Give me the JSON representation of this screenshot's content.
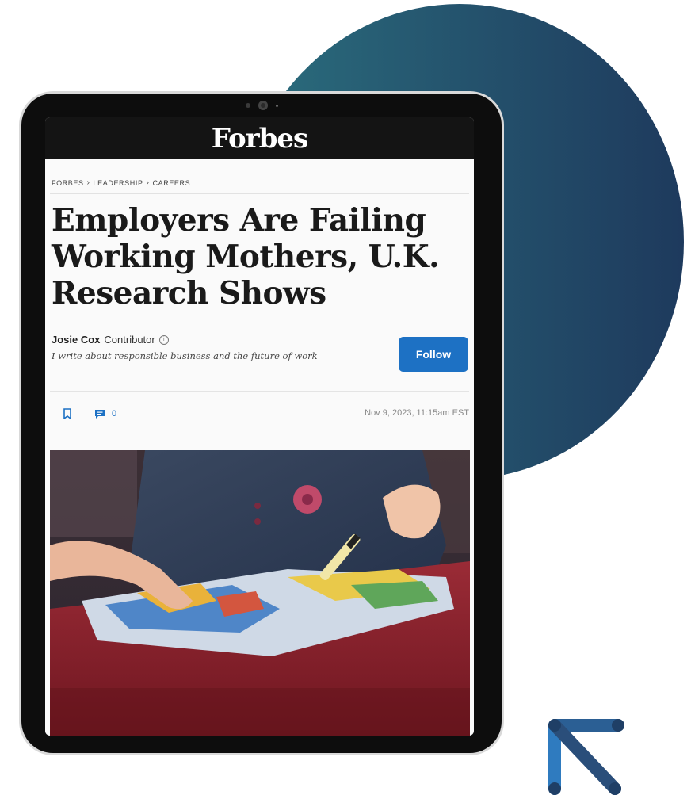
{
  "brand": {
    "logo_text": "Forbes"
  },
  "breadcrumb": [
    "FORBES",
    "LEADERSHIP",
    "CAREERS"
  ],
  "breadcrumb_separator": "›",
  "article": {
    "headline_lines": [
      "Employers Are Failing",
      "Working Mothers, U.K.",
      "Research Shows"
    ],
    "author": "Josie Cox",
    "role": "Contributor",
    "tagline": "I write about responsible business and the future of work",
    "follow_label": "Follow",
    "comment_count": "0",
    "date": "Nov 9, 2023, 11:15am EST"
  },
  "icons": [
    "bookmark-icon",
    "comment-icon",
    "info-icon",
    "arrow-logo-icon"
  ],
  "colors": {
    "accent_blue": "#1d71c4",
    "masthead": "#141414",
    "circle_left": "#2b6f7e",
    "circle_right": "#1e3a5d"
  }
}
